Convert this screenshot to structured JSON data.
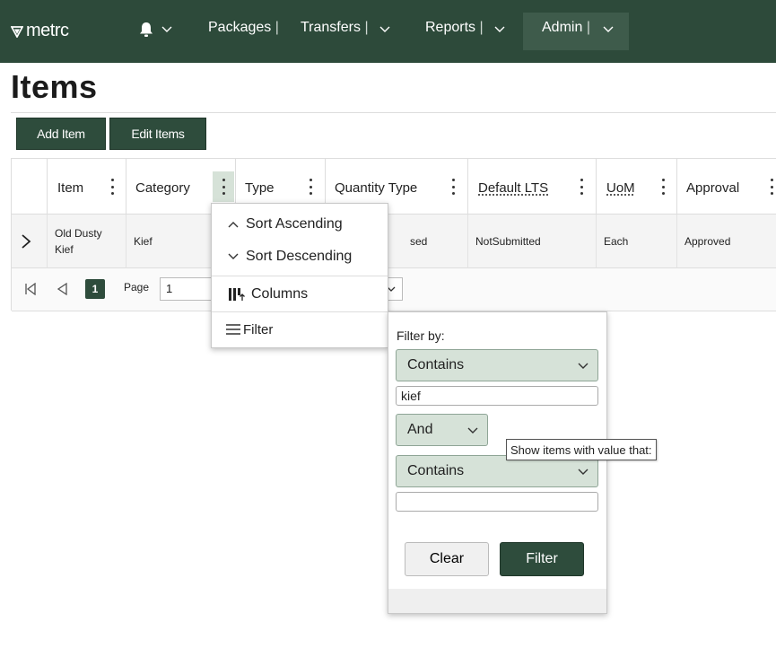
{
  "nav": {
    "logo": "metrc",
    "items": [
      {
        "label": "Packages",
        "sep": "|"
      },
      {
        "label": "Transfers",
        "sep": "|"
      },
      {
        "label": "Reports",
        "sep": "|"
      },
      {
        "label": "Admin",
        "sep": "|"
      }
    ]
  },
  "page": {
    "title": "Items"
  },
  "toolbar": {
    "add_label": "Add Item",
    "edit_label": "Edit Items"
  },
  "grid": {
    "columns": [
      "Item",
      "Category",
      "Type",
      "Quantity Type",
      "Default LTS",
      "UoM",
      "Approval"
    ],
    "row": {
      "item": "Old Dusty\nKief",
      "category": "Kief",
      "quantity_type_partial": "sed",
      "default_lts": "NotSubmitted",
      "uom": "Each",
      "approval": "Approved"
    }
  },
  "pager": {
    "current_page": "1",
    "page_label": "Page",
    "page_input": "1"
  },
  "column_menu": {
    "sort_asc": "Sort Ascending",
    "sort_desc": "Sort Descending",
    "columns": "Columns",
    "filter": "Filter"
  },
  "filter_popup": {
    "filter_by": "Filter by:",
    "operator1": "Contains",
    "value1": "kief",
    "logic": "And",
    "operator2": "Contains",
    "value2": "",
    "clear_label": "Clear",
    "filter_label": "Filter"
  },
  "tooltip": "Show items with value that:",
  "colors": {
    "nav_bg": "#2d4a3a",
    "accent": "#2e4c3c",
    "light_accent": "#d6e2d8"
  }
}
